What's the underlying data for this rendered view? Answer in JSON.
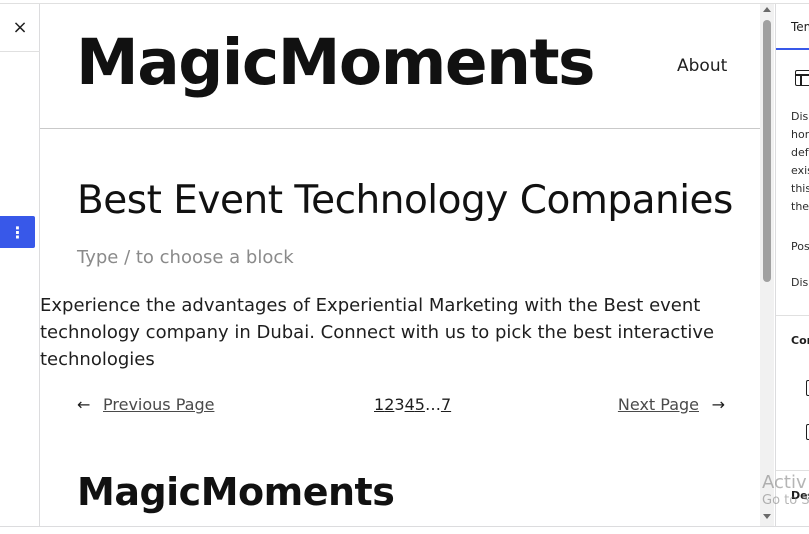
{
  "editor": {
    "close_label": "×",
    "block_options_label": "⋮"
  },
  "site": {
    "title": "MagicMoments",
    "nav_about": "About"
  },
  "post": {
    "title": "Best Event Technology Companies",
    "block_placeholder": "Type / to choose a block",
    "excerpt": "Experience the advantages of Experiential Marketing with the Best event technology company in Dubai. Connect with us to pick the best interactive technologies"
  },
  "pagination": {
    "prev_arrow": "←",
    "prev_label": "Previous Page",
    "pages": [
      "1",
      "2",
      "3",
      "4",
      "5",
      "…",
      "7"
    ],
    "current_page": "3",
    "next_label": "Next Page",
    "next_arrow": "→"
  },
  "footer": {
    "title": "MagicMoments"
  },
  "sidebar": {
    "tab_label": "Tem",
    "description_lines": [
      "Dis",
      "hor",
      "def",
      "exis",
      "this",
      "the"
    ],
    "posts_label": "Pos",
    "display_label": "Dis",
    "content_heading": "Cor",
    "design_heading": "Des"
  },
  "watermark": {
    "line1": "Activ",
    "line2": "Go to S"
  },
  "icons": {
    "close": "close-icon",
    "block_options": "more-vertical-icon",
    "template": "layout-template-icon",
    "prev": "arrow-left-icon",
    "next": "arrow-right-icon"
  },
  "colors": {
    "accent": "#3858e9",
    "text": "#1e1e1e",
    "placeholder": "#8a8a8a"
  }
}
